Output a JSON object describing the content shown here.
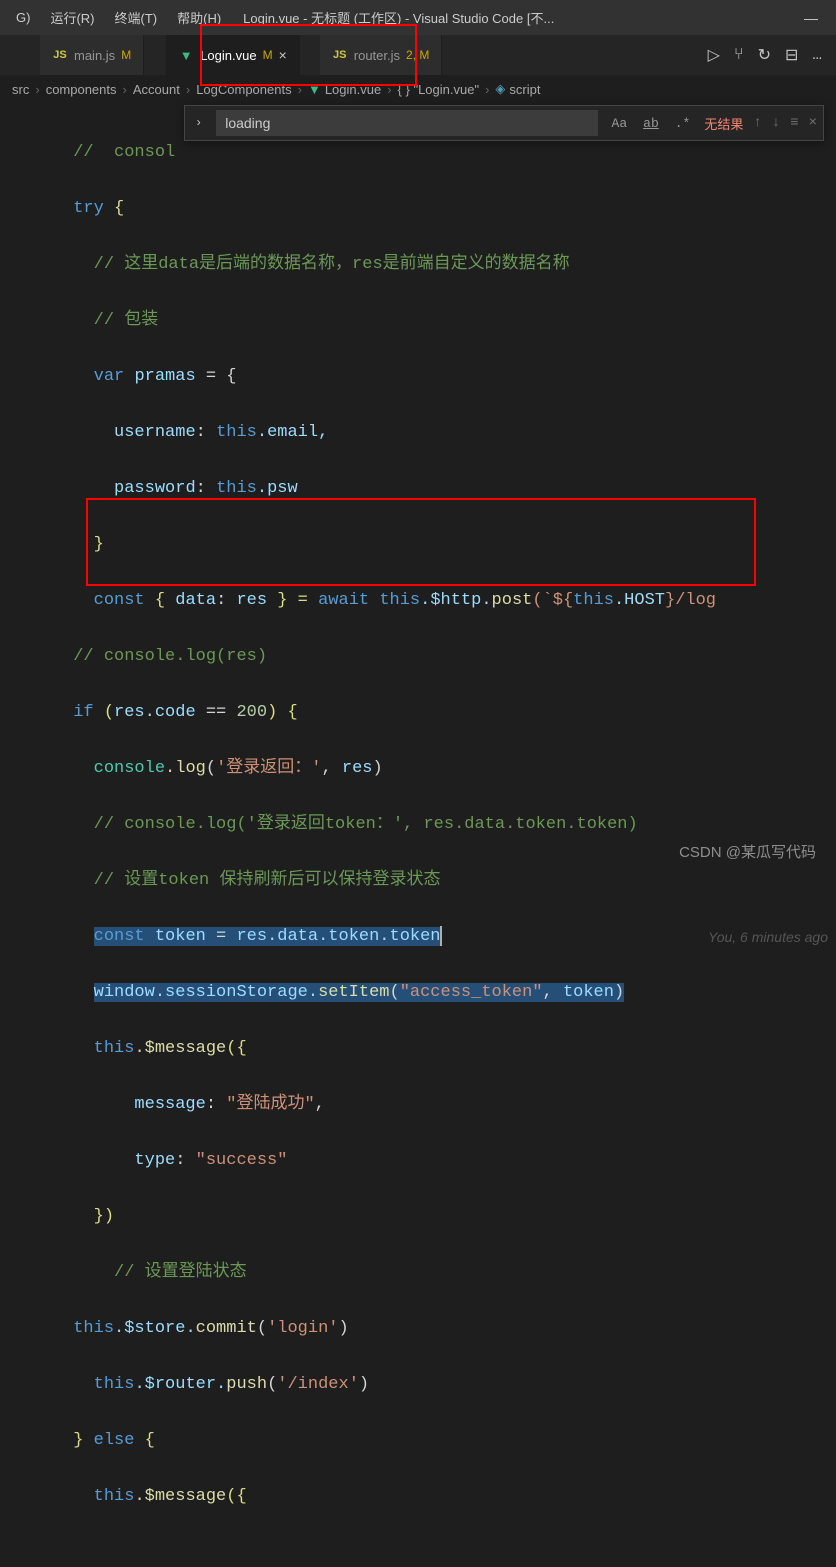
{
  "menubar": {
    "items": [
      "G)",
      "运行(R)",
      "终端(T)",
      "帮助(H)"
    ],
    "title": "Login.vue - 无标题 (工作区) - Visual Studio Code [不...",
    "controls": [
      "—"
    ]
  },
  "tabs": {
    "items": [
      {
        "icon": "js",
        "label": "main.js",
        "mod": "M"
      },
      {
        "icon": "vue",
        "label": "Login.vue",
        "mod": "M",
        "active": true,
        "close": "×"
      },
      {
        "icon": "js",
        "label": "router.js",
        "mod": "2, M"
      }
    ],
    "actions": [
      "▷",
      "⑂",
      "↻",
      "⊟",
      "…"
    ]
  },
  "breadcrumbs": {
    "parts": [
      "src",
      "components",
      "Account",
      "LogComponents",
      "Login.vue",
      "{ } \"Login.vue\"",
      "script"
    ]
  },
  "search": {
    "value": "loading",
    "opts": [
      "Aa",
      "ab",
      ".*"
    ],
    "results": "无结果",
    "nav": [
      "↑",
      "↓",
      "≡",
      "×"
    ]
  },
  "code": {
    "l1": "//  consol",
    "l2_try": "try",
    "l2_brace": " {",
    "l3": "// 这里data是后端的数据名称，res是前端自定义的数据名称",
    "l4": "// 包装",
    "l5_var": "var ",
    "l5_name": "pramas",
    "l5_eq": " = {",
    "l6_k": "username",
    "l6_sep": ": ",
    "l6_this": "this",
    "l6_prop": ".email,",
    "l7_k": "password",
    "l7_this": "this",
    "l7_prop": ".psw",
    "l8": "}",
    "l9_const": "const ",
    "l9_destruct": "{ ",
    "l9_data": "data",
    "l9_colon": ": ",
    "l9_res": "res",
    "l9_close": " } = ",
    "l9_await": "await ",
    "l9_this": "this",
    "l9_http": ".$http.",
    "l9_post": "post",
    "l9_tick": "(`${",
    "l9_host_this": "this",
    "l9_host": ".HOST",
    "l9_end": "}/log",
    "l10": "// console.log(res)",
    "l11_if": "if ",
    "l11_open": "(",
    "l11_res": "res",
    "l11_code": ".code",
    "l11_eq": " == ",
    "l11_200": "200",
    "l11_close": ") {",
    "l12_console": "console",
    "l12_log": ".log",
    "l12_str": "'登录返回：'",
    "l12_res": "res",
    "l13": "// console.log('登录返回token：', res.data.token.token)",
    "l14": "// 设置token 保持刷新后可以保持登录状态",
    "l15_const": "const ",
    "l15_token": "token",
    "l15_eq": " = ",
    "l15_res": "res",
    "l15_chain": ".data.token.token",
    "l15_gitlens": "You, 6 minutes ago",
    "l16_window": "window",
    "l16_ss": ".sessionStorage.",
    "l16_set": "setItem",
    "l16_str": "\"access_token\"",
    "l16_token": "token",
    "l17_this": "this",
    "l17_msg": ".$message",
    "l17_brace": "({",
    "l18_k": "message",
    "l18_v": "\"登陆成功\"",
    "l19_k": "type",
    "l19_v": "\"success\"",
    "l20": "})",
    "l21": "// 设置登陆状态",
    "l22_this": "this",
    "l22_store": ".$store.",
    "l22_commit": "commit",
    "l22_str": "'login'",
    "l23_this": "this",
    "l23_router": ".$router.",
    "l23_push": "push",
    "l23_str": "'/index'",
    "l24_close": "} ",
    "l24_else": "else",
    "l24_open": " {",
    "l25_this": "this",
    "l25_msg": ".$message",
    "l25_brace": "({"
  },
  "watermark": "CSDN @某瓜写代码"
}
